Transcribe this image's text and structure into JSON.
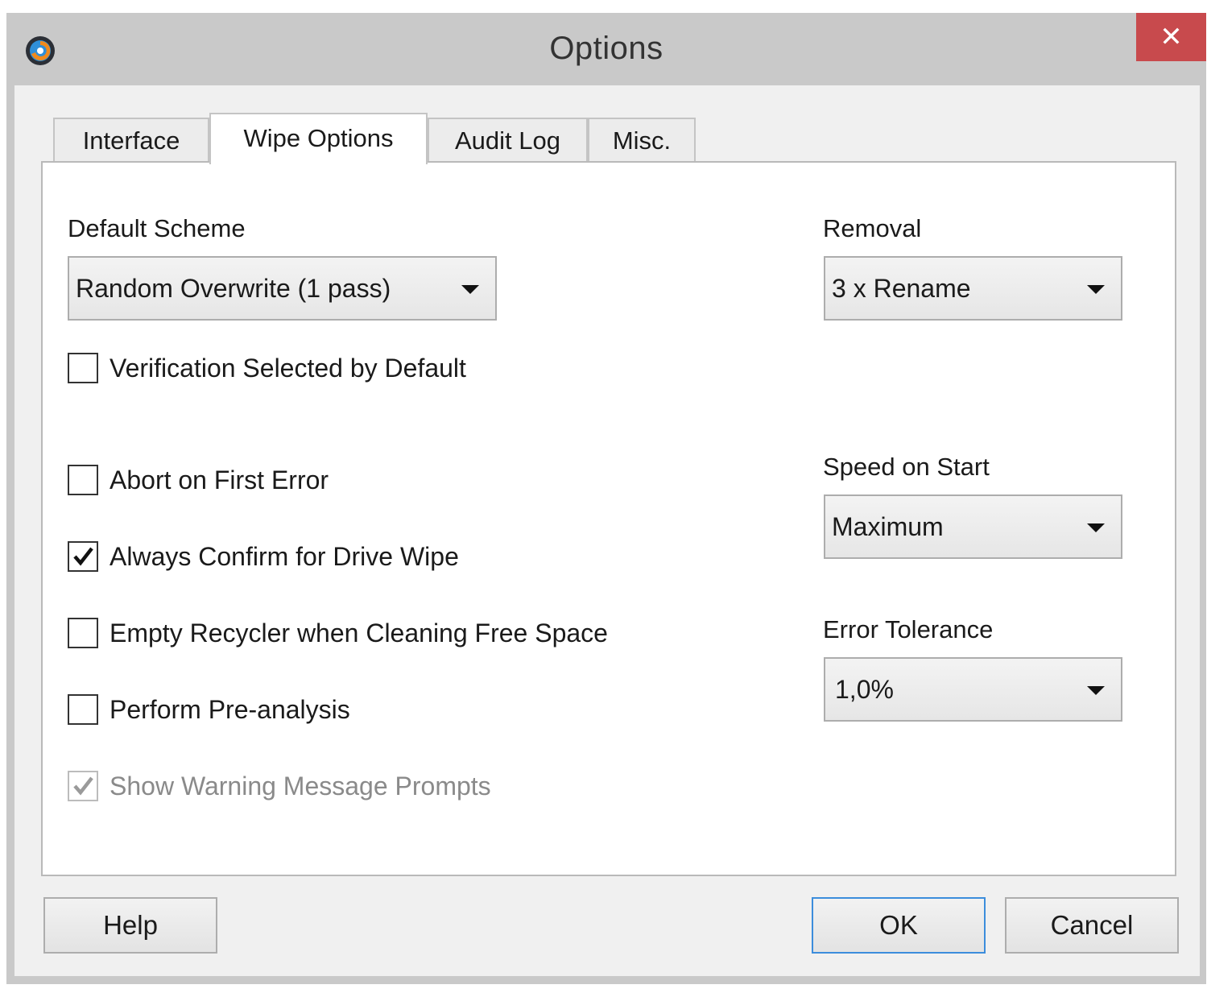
{
  "window": {
    "title": "Options",
    "close_label": "✕"
  },
  "tabs": [
    {
      "label": "Interface"
    },
    {
      "label": "Wipe Options",
      "active": true
    },
    {
      "label": "Audit Log"
    },
    {
      "label": "Misc."
    }
  ],
  "wipe": {
    "default_scheme": {
      "label": "Default Scheme",
      "value": "Random Overwrite (1 pass)"
    },
    "removal": {
      "label": "Removal",
      "value": "3 x Rename"
    },
    "speed": {
      "label": "Speed on Start",
      "value": "Maximum"
    },
    "error_tolerance": {
      "label": "Error Tolerance",
      "value": "1,0%"
    },
    "checkboxes": [
      {
        "label": "Verification Selected by Default",
        "checked": false,
        "disabled": false
      },
      {
        "label": "Abort on First Error",
        "checked": false,
        "disabled": false
      },
      {
        "label": "Always Confirm for Drive Wipe",
        "checked": true,
        "disabled": false
      },
      {
        "label": "Empty Recycler when Cleaning Free Space",
        "checked": false,
        "disabled": false
      },
      {
        "label": "Perform Pre-analysis",
        "checked": false,
        "disabled": false
      },
      {
        "label": "Show Warning Message Prompts",
        "checked": true,
        "disabled": true
      }
    ]
  },
  "buttons": {
    "help": "Help",
    "ok": "OK",
    "cancel": "Cancel"
  },
  "colors": {
    "close_button": "#c84a4d",
    "default_button_border": "#3c8ddc"
  }
}
